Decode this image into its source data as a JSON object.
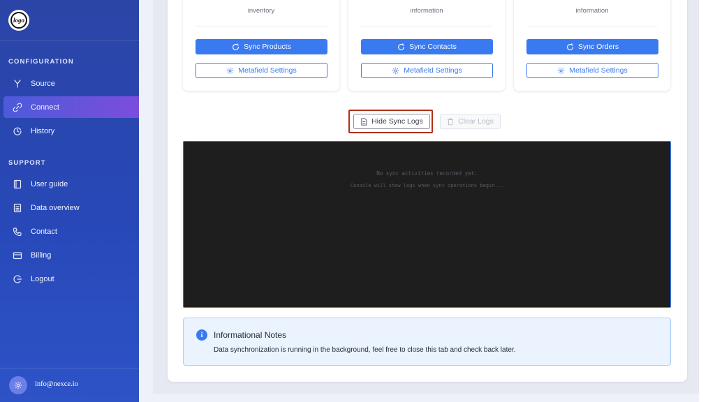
{
  "sidebar": {
    "logo_text": "logo",
    "sections": {
      "configuration": "CONFIGURATION",
      "support": "SUPPORT"
    },
    "items": {
      "source": "Source",
      "connect": "Connect",
      "history": "History",
      "user_guide": "User guide",
      "data_overview": "Data overview",
      "contact": "Contact",
      "billing": "Billing",
      "logout": "Logout"
    },
    "active_item": "Connect",
    "footer_email": "info@nexce.io"
  },
  "cards": [
    {
      "description": "inventory",
      "sync_label": "Sync Products",
      "metafield_label": "Metafield Settings"
    },
    {
      "description": "information",
      "sync_label": "Sync Contacts",
      "metafield_label": "Metafield Settings"
    },
    {
      "description": "information",
      "sync_label": "Sync Orders",
      "metafield_label": "Metafield Settings"
    }
  ],
  "logs": {
    "hide_label": "Hide Sync Logs",
    "clear_label": "Clear Logs",
    "empty_line_1": "No sync activities recorded yet.",
    "empty_line_2": "Console will show logs when sync operations begin..."
  },
  "info": {
    "icon_glyph": "i",
    "title": "Informational Notes",
    "text": "Data synchronization is running in the background, feel free to close this tab and check back later."
  },
  "colors": {
    "primary": "#3a7af0",
    "sidebar": "#2b45a6",
    "active_nav_start": "#4c5bd9",
    "active_nav_end": "#7c4ddc",
    "console_bg": "#1e1e1e",
    "highlight": "#b02f1c"
  },
  "icons": {
    "source": "fork-icon",
    "connect": "link-icon",
    "history": "clock-icon",
    "user_guide": "book-icon",
    "data_overview": "document-icon",
    "contact": "phone-icon",
    "billing": "credit-card-icon",
    "logout": "logout-icon",
    "sync": "refresh-icon",
    "metafield": "gear-icon",
    "hide_logs": "file-icon",
    "clear_logs": "trash-icon",
    "info": "info-icon"
  }
}
